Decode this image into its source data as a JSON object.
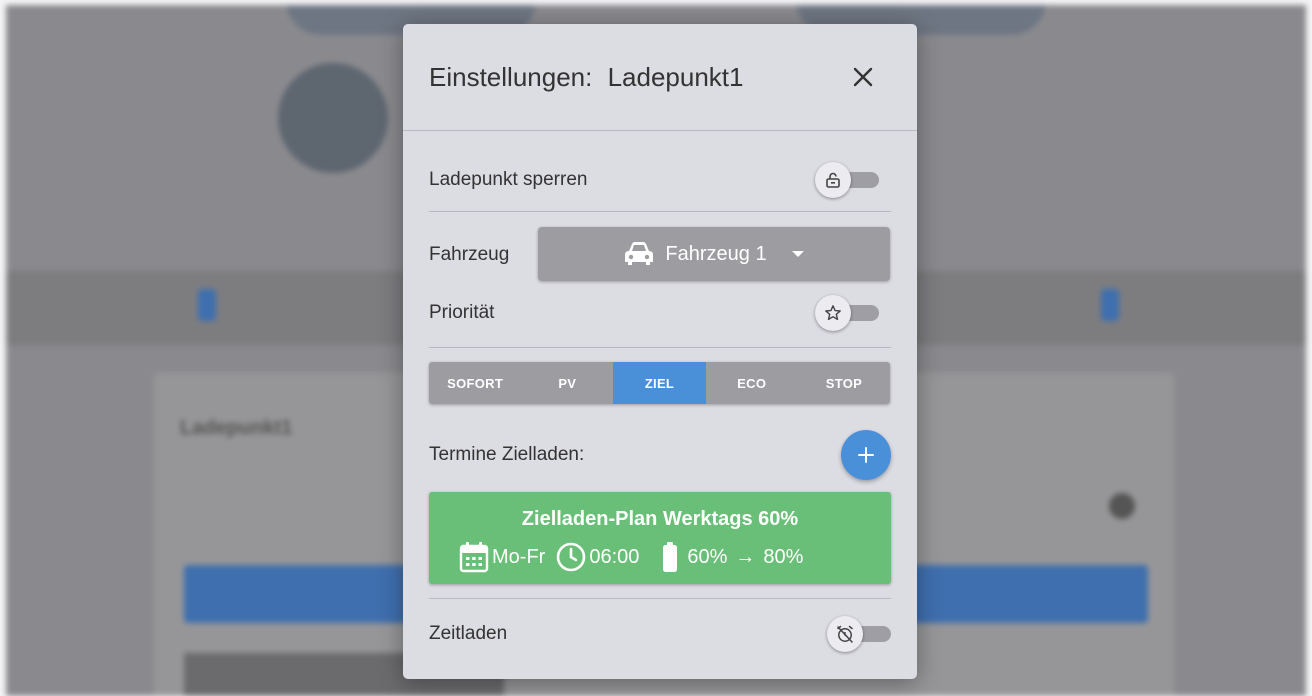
{
  "modal": {
    "title": "Einstellungen:",
    "chargepoint_name": "Ladepunkt1"
  },
  "lock": {
    "label": "Ladepunkt sperren",
    "icon": "lock-open-icon",
    "enabled": false
  },
  "vehicle": {
    "label": "Fahrzeug",
    "selected": "Fahrzeug 1",
    "icon": "car-icon"
  },
  "priority": {
    "label": "Priorität",
    "icon": "star-icon",
    "enabled": false
  },
  "modes": {
    "items": [
      {
        "label": "SOFORT"
      },
      {
        "label": "PV"
      },
      {
        "label": "ZIEL"
      },
      {
        "label": "ECO"
      },
      {
        "label": "STOP"
      }
    ],
    "active": "ZIEL",
    "active_color": "#4a90d9"
  },
  "schedule": {
    "label": "Termine Zielladen:",
    "plans": [
      {
        "title": "Zielladen-Plan Werktags 60%",
        "days": "Mo-Fr",
        "time": "06:00",
        "soc_from": "60%",
        "arrow": "→",
        "soc_to": "80%",
        "color": "#6abf78"
      }
    ]
  },
  "timed": {
    "label": "Zeitladen",
    "icon": "alarm-off-icon",
    "enabled": false
  },
  "background": {
    "card_title": "Ladepunkt1"
  }
}
